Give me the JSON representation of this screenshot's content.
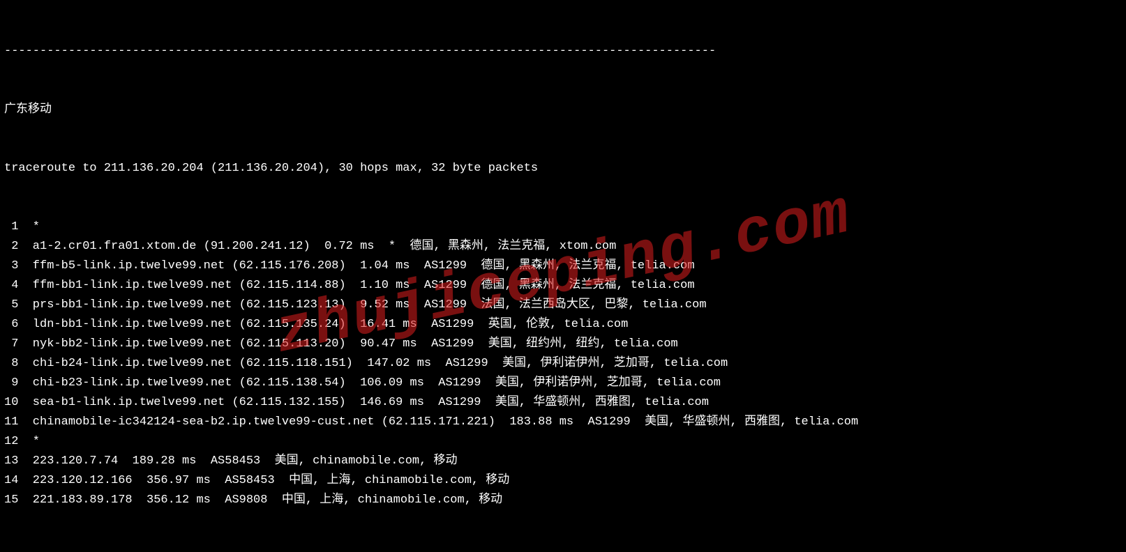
{
  "terminal": {
    "divider": "----------------------------------------------------------------------------------------------------",
    "title": "广东移动",
    "command": "traceroute to 211.136.20.204 (211.136.20.204), 30 hops max, 32 byte packets",
    "hops": [
      {
        "n": " 1",
        "text": "*"
      },
      {
        "n": " 2",
        "text": "a1-2.cr01.fra01.xtom.de (91.200.241.12)  0.72 ms  *  德国, 黑森州, 法兰克福, xtom.com"
      },
      {
        "n": " 3",
        "text": "ffm-b5-link.ip.twelve99.net (62.115.176.208)  1.04 ms  AS1299  德国, 黑森州, 法兰克福, telia.com"
      },
      {
        "n": " 4",
        "text": "ffm-bb1-link.ip.twelve99.net (62.115.114.88)  1.10 ms  AS1299  德国, 黑森州, 法兰克福, telia.com"
      },
      {
        "n": " 5",
        "text": "prs-bb1-link.ip.twelve99.net (62.115.123.13)  9.52 ms  AS1299  法国, 法兰西岛大区, 巴黎, telia.com"
      },
      {
        "n": " 6",
        "text": "ldn-bb1-link.ip.twelve99.net (62.115.135.24)  16.41 ms  AS1299  英国, 伦敦, telia.com"
      },
      {
        "n": " 7",
        "text": "nyk-bb2-link.ip.twelve99.net (62.115.113.20)  90.47 ms  AS1299  美国, 纽约州, 纽约, telia.com"
      },
      {
        "n": " 8",
        "text": "chi-b24-link.ip.twelve99.net (62.115.118.151)  147.02 ms  AS1299  美国, 伊利诺伊州, 芝加哥, telia.com"
      },
      {
        "n": " 9",
        "text": "chi-b23-link.ip.twelve99.net (62.115.138.54)  106.09 ms  AS1299  美国, 伊利诺伊州, 芝加哥, telia.com"
      },
      {
        "n": "10",
        "text": "sea-b1-link.ip.twelve99.net (62.115.132.155)  146.69 ms  AS1299  美国, 华盛顿州, 西雅图, telia.com"
      },
      {
        "n": "11",
        "text": "chinamobile-ic342124-sea-b2.ip.twelve99-cust.net (62.115.171.221)  183.88 ms  AS1299  美国, 华盛顿州, 西雅图, telia.com"
      },
      {
        "n": "12",
        "text": "*"
      },
      {
        "n": "13",
        "text": "223.120.7.74  189.28 ms  AS58453  美国, chinamobile.com, 移动"
      },
      {
        "n": "14",
        "text": "223.120.12.166  356.97 ms  AS58453  中国, 上海, chinamobile.com, 移动"
      },
      {
        "n": "15",
        "text": "221.183.89.178  356.12 ms  AS9808  中国, 上海, chinamobile.com, 移动"
      }
    ]
  },
  "watermark": "zhujiceping.com"
}
